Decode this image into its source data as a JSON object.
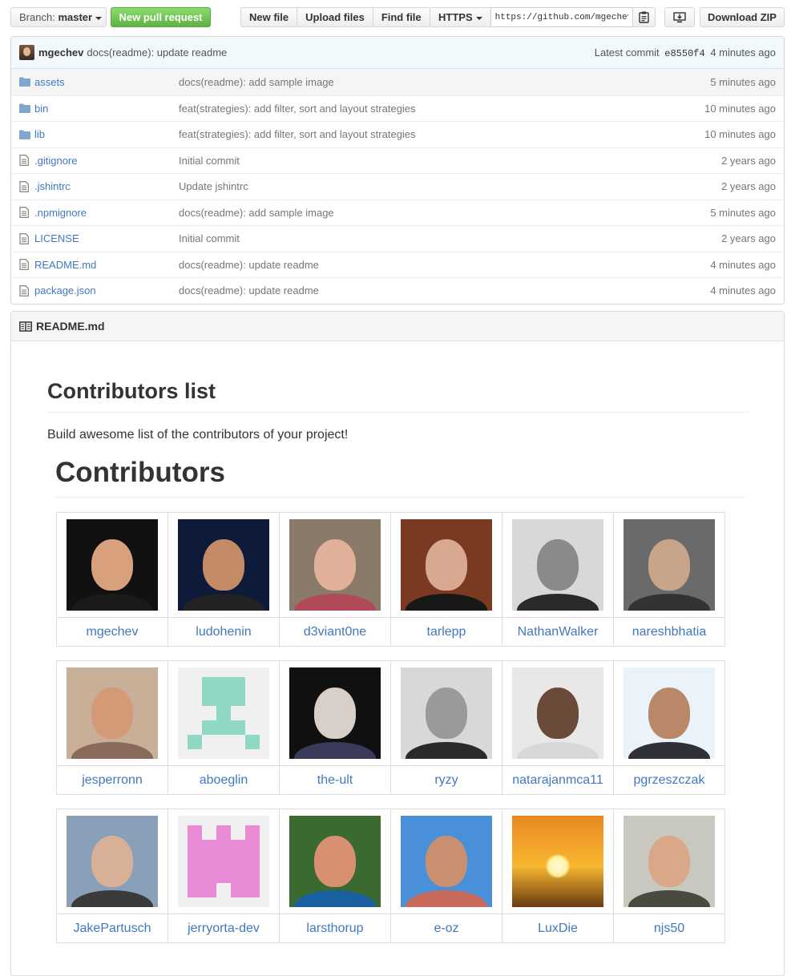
{
  "toolbar": {
    "branch_prefix": "Branch:",
    "branch_name": "master",
    "new_pull_request": "New pull request",
    "new_file": "New file",
    "upload_files": "Upload files",
    "find_file": "Find file",
    "clone_protocol": "HTTPS",
    "clone_url": "https://github.com/mgechev/contributors-list",
    "download_zip": "Download ZIP"
  },
  "latest_commit": {
    "author": "mgechev",
    "message": "docs(readme): update readme",
    "prefix": "Latest commit",
    "sha": "e8550f4",
    "age": "4 minutes ago"
  },
  "files": [
    {
      "name": "assets",
      "type": "dir",
      "message": "docs(readme): add sample image",
      "age": "5 minutes ago"
    },
    {
      "name": "bin",
      "type": "dir",
      "message": "feat(strategies): add filter, sort and layout strategies",
      "age": "10 minutes ago"
    },
    {
      "name": "lib",
      "type": "dir",
      "message": "feat(strategies): add filter, sort and layout strategies",
      "age": "10 minutes ago"
    },
    {
      "name": ".gitignore",
      "type": "file",
      "message": "Initial commit",
      "age": "2 years ago"
    },
    {
      "name": ".jshintrc",
      "type": "file",
      "message": "Update jshintrc",
      "age": "2 years ago"
    },
    {
      "name": ".npmignore",
      "type": "file",
      "message": "docs(readme): add sample image",
      "age": "5 minutes ago"
    },
    {
      "name": "LICENSE",
      "type": "file",
      "message": "Initial commit",
      "age": "2 years ago"
    },
    {
      "name": "README.md",
      "type": "file",
      "message": "docs(readme): update readme",
      "age": "4 minutes ago"
    },
    {
      "name": "package.json",
      "type": "file",
      "message": "docs(readme): update readme",
      "age": "4 minutes ago"
    }
  ],
  "readme": {
    "filename": "README.md",
    "title": "Contributors list",
    "description": "Build awesome list of the contributors of your project!",
    "subtitle": "Contributors",
    "contributors": [
      {
        "login": "mgechev",
        "bg": "#111111",
        "skin": "#d9a07e",
        "shirt": "#1a1a1a"
      },
      {
        "login": "ludohenin",
        "bg": "#0d1a3a",
        "skin": "#c48a66",
        "shirt": "#222"
      },
      {
        "login": "d3viant0ne",
        "bg": "#8a7a6a",
        "skin": "#e0b098",
        "shirt": "#b04a5a"
      },
      {
        "login": "tarlepp",
        "bg": "#7a3a22",
        "skin": "#d8a890",
        "shirt": "#181818"
      },
      {
        "login": "NathanWalker",
        "bg": "#d8d8d8",
        "skin": "#8a8a8a",
        "shirt": "#2a2a2a"
      },
      {
        "login": "nareshbhatia",
        "bg": "#6a6a6a",
        "skin": "#c8a488",
        "shirt": "#333"
      },
      {
        "login": "jesperronn",
        "bg": "#c8b098",
        "skin": "#d49a78",
        "shirt": "#8a6a5a"
      },
      {
        "login": "aboeglin",
        "bg": "#f0f0f0",
        "skin": "#8fd9c4",
        "shirt": "#8fd9c4",
        "identicon": true
      },
      {
        "login": "the-ult",
        "bg": "#101010",
        "skin": "#d8d0c8",
        "shirt": "#3a3a5a"
      },
      {
        "login": "ryzy",
        "bg": "#d8d8d8",
        "skin": "#9a9a9a",
        "shirt": "#2a2a2a"
      },
      {
        "login": "natarajanmca11",
        "bg": "#e8e8e8",
        "skin": "#6a4a38",
        "shirt": "#d8d8d8"
      },
      {
        "login": "pgrzeszczak",
        "bg": "#eaf2fa",
        "skin": "#b88868",
        "shirt": "#30303a"
      },
      {
        "login": "JakePartusch",
        "bg": "#8aa0b8",
        "skin": "#d8b098",
        "shirt": "#3a3a3a"
      },
      {
        "login": "jerryorta-dev",
        "bg": "#f0f0f0",
        "skin": "#e88ad4",
        "shirt": "#e88ad4",
        "identicon": true
      },
      {
        "login": "larsthorup",
        "bg": "#3a6a30",
        "skin": "#d89070",
        "shirt": "#1a60a0"
      },
      {
        "login": "e-oz",
        "bg": "#4a90d8",
        "skin": "#c89070",
        "shirt": "#c86a5a"
      },
      {
        "login": "LuxDie",
        "bg": "#e88820",
        "skin": "#fff0a0",
        "shirt": "#6a3a10",
        "sunset": true
      },
      {
        "login": "njs50",
        "bg": "#c8c8c0",
        "skin": "#d8a888",
        "shirt": "#4a4a40"
      }
    ]
  },
  "colors": {
    "link": "#4078c0",
    "green_button": "#60b044",
    "commit_bar": "#f2f9fc"
  },
  "icons": {
    "directory": "folder-icon",
    "file": "file-text-icon",
    "readme": "book-icon",
    "clipboard": "clipboard-icon",
    "desktop": "desktop-download-icon"
  }
}
